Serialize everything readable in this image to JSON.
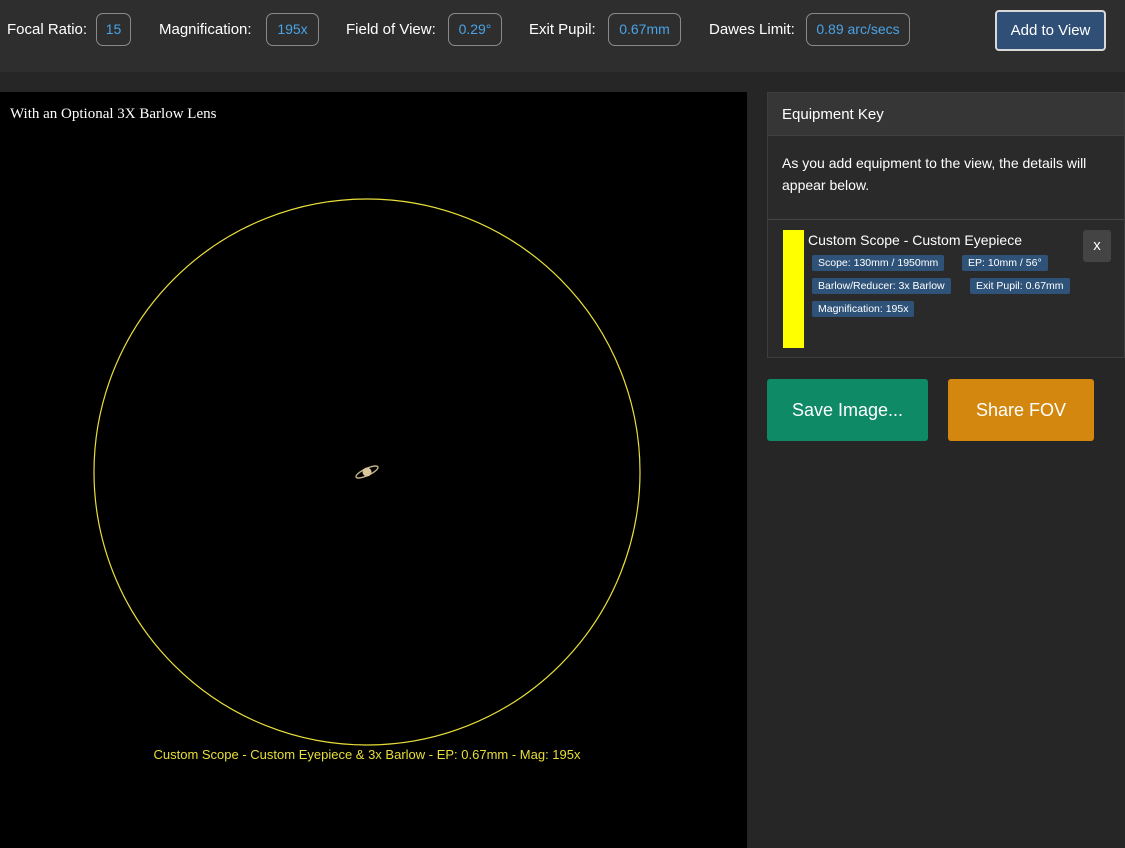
{
  "toolbar": {
    "stats": [
      {
        "label": "Focal Ratio:",
        "value": "15"
      },
      {
        "label": "Magnification:",
        "value": "195x"
      },
      {
        "label": "Field of View:",
        "value": "0.29°"
      },
      {
        "label": "Exit Pupil:",
        "value": "0.67mm"
      },
      {
        "label": "Dawes Limit:",
        "value": "0.89 arc/secs"
      }
    ],
    "add_label": "Add to View"
  },
  "view": {
    "title": "With an Optional 3X Barlow Lens",
    "caption": "Custom Scope - Custom Eyepiece & 3x Barlow - EP: 0.67mm - Mag: 195x",
    "circle_color": "#e8df3a",
    "object_icon": "saturn-icon"
  },
  "equipment_key": {
    "header": "Equipment Key",
    "description": "As you add equipment to the view, the details will appear below.",
    "entries": [
      {
        "title": "Custom Scope - Custom Eyepiece",
        "color": "#ffff00",
        "remove_label": "x",
        "tags": [
          "Scope: 130mm / 1950mm",
          "EP: 10mm / 56°",
          "Barlow/Reducer: 3x Barlow",
          "Exit Pupil: 0.67mm",
          "Magnification: 195x"
        ]
      }
    ]
  },
  "actions": {
    "save_label": "Save Image...",
    "share_label": "Share FOV",
    "save_color": "#0e8a66",
    "share_color": "#d3870e"
  }
}
